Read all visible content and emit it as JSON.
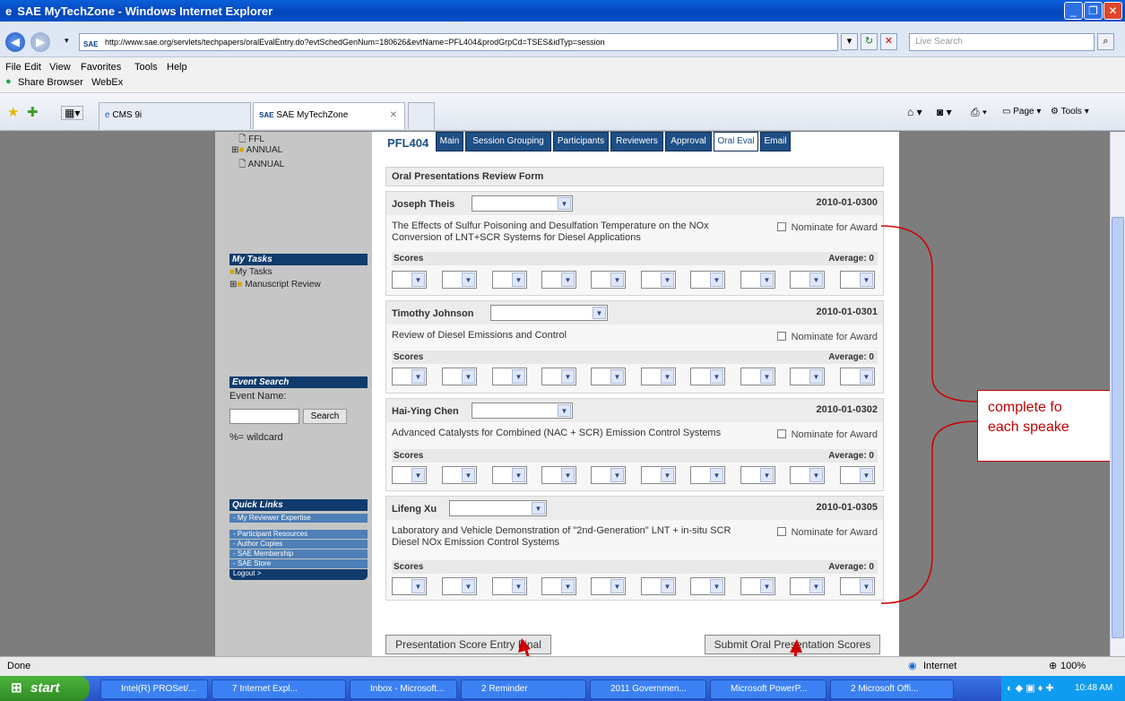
{
  "window": {
    "title": "SAE MyTechZone - Windows Internet Explorer"
  },
  "address": {
    "url": "http://www.sae.org/servlets/techpapers/oralEvalEntry.do?evtSchedGenNum=180626&evtName=PFL404&prodGrpCd=TSES&idTyp=session",
    "search_placeholder": "Live Search"
  },
  "menu": {
    "file": "File",
    "edit": "Edit",
    "view": "View",
    "favorites": "Favorites",
    "tools": "Tools",
    "help": "Help",
    "share": "Share Browser",
    "webex": "WebEx"
  },
  "tabs": {
    "tab1": "CMS 9i",
    "tab2": "SAE MyTechZone"
  },
  "toolbar": {
    "page": "Page",
    "tools": "Tools"
  },
  "sidebar": {
    "tree": [
      "FFL",
      "ANNUAL",
      "ANNUAL"
    ],
    "my_tasks_header": "My Tasks",
    "my_tasks": "My Tasks",
    "manuscript_review": "Manuscript Review",
    "event_search_header": "Event Search",
    "event_name": "Event Name:",
    "search_button": "Search",
    "wildcard": "%= wildcard",
    "quick_links_header": "Quick Links",
    "quick_links": [
      "- My Reviewer Expertise",
      "- Participant Resources",
      "- Author Copies",
      "- SAE Membership",
      "- SAE Store",
      "Logout >"
    ]
  },
  "session": {
    "code": "PFL404",
    "tabs": [
      "Main",
      "Session Grouping",
      "Participants",
      "Reviewers",
      "Approval",
      "Oral Eval",
      "Email"
    ]
  },
  "form": {
    "header": "Oral Presentations Review Form",
    "scores_label": "Scores",
    "nominate_label": "Nominate for Award",
    "average_label": "Average: 0",
    "speakers": [
      {
        "name": "Joseph Theis",
        "number": "2010-01-0300",
        "title": "The Effects of Sulfur Poisoning and Desulfation Temperature on the NOx Conversion of LNT+SCR Systems for Diesel Applications"
      },
      {
        "name": "Timothy Johnson",
        "number": "2010-01-0301",
        "title": "Review of Diesel Emissions and Control"
      },
      {
        "name": "Hai-Ying Chen",
        "number": "2010-01-0302",
        "title": "Advanced Catalysts for Combined (NAC + SCR) Emission Control Systems"
      },
      {
        "name": "Lifeng Xu",
        "number": "2010-01-0305",
        "title": "Laboratory and Vehicle Demonstration of \"2nd-Generation\" LNT + in-situ SCR Diesel NOx Emission Control Systems"
      }
    ]
  },
  "buttons": {
    "final": "Presentation Score Entry Final",
    "submit": "Submit Oral Presentation Scores"
  },
  "callout": {
    "line1": "complete fo",
    "line2": "each speake"
  },
  "status": {
    "text": "Done",
    "zone": "Internet",
    "zoom": "100%"
  },
  "taskbar": {
    "start": "start",
    "items": [
      "Intel(R) PROSet/...",
      "7 Internet Expl...",
      "Inbox - Microsoft...",
      "2 Reminder",
      "2011 Governmen...",
      "Microsoft PowerP...",
      "2 Microsoft Offi..."
    ],
    "clock": "10:48 AM"
  },
  "colors": {
    "annotation": "#c00000",
    "sae_blue": "#1e4f86"
  }
}
